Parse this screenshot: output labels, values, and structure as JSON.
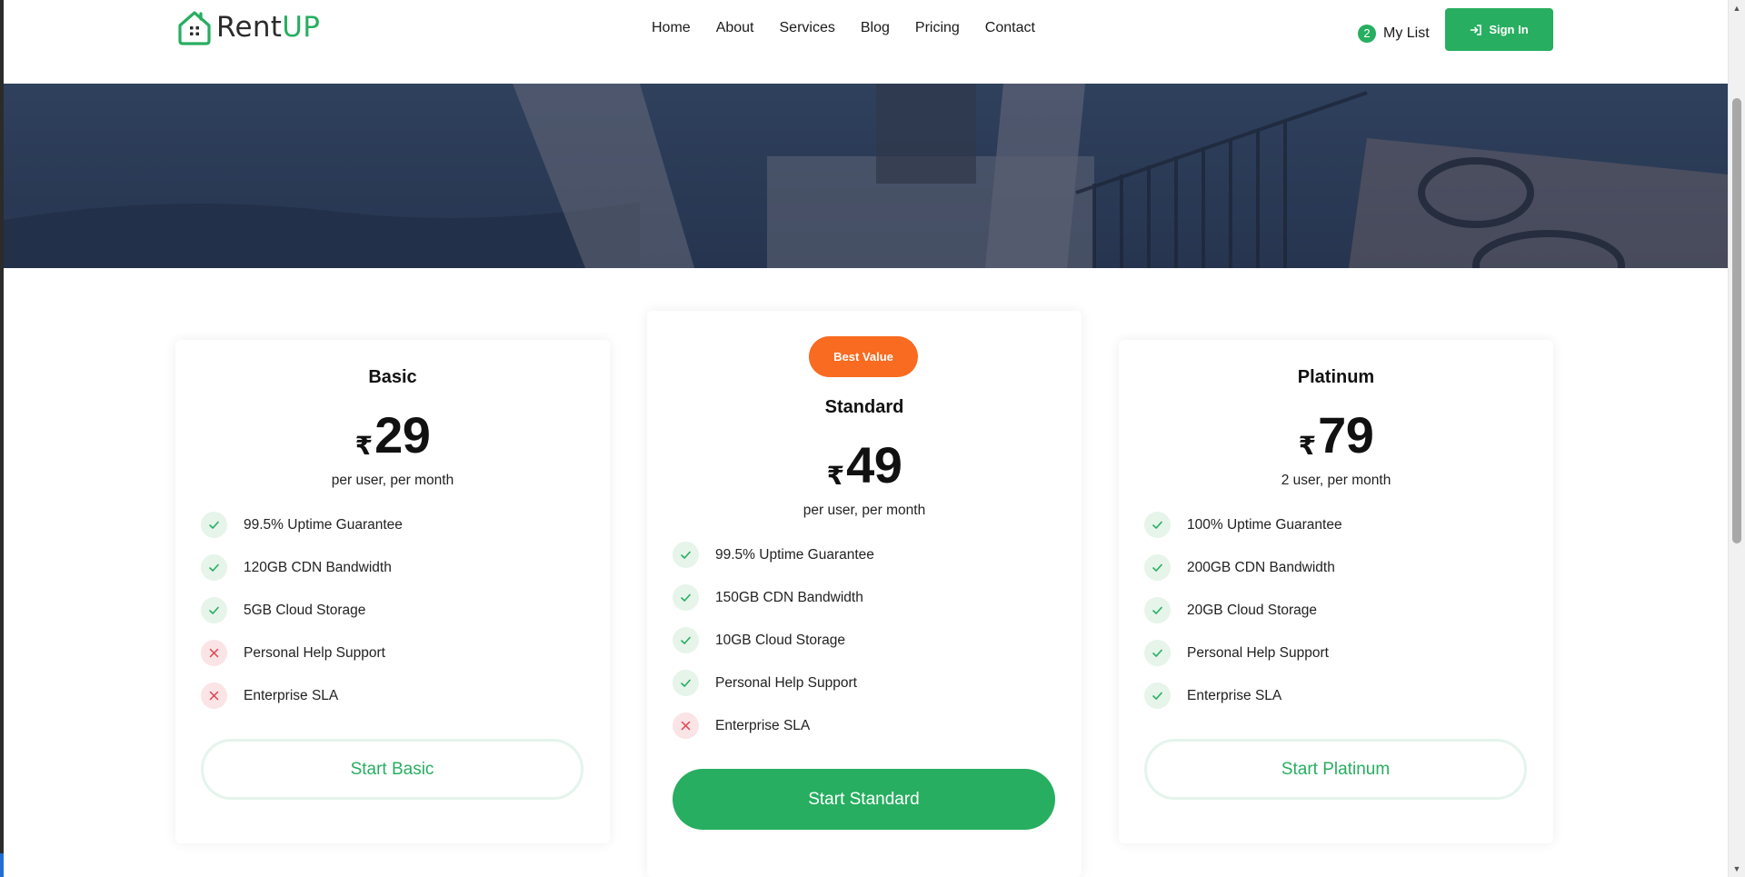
{
  "brand": {
    "name_part1": "Rent",
    "name_part2": "UP",
    "colors": {
      "primary": "#27ae60",
      "badge": "#f96b20",
      "negative": "#e0434f"
    }
  },
  "nav": {
    "items": [
      {
        "label": "Home"
      },
      {
        "label": "About"
      },
      {
        "label": "Services"
      },
      {
        "label": "Blog"
      },
      {
        "label": "Pricing"
      },
      {
        "label": "Contact"
      }
    ]
  },
  "mylist": {
    "count": "2",
    "label": "My List"
  },
  "signin": {
    "label": "Sign In",
    "icon": "sign-in-icon"
  },
  "hero": {
    "image": "hotel-balcony-sea-view"
  },
  "plans": [
    {
      "name": "Basic",
      "currency": "₹",
      "price": "29",
      "period": "per user, per month",
      "features": [
        {
          "label": "99.5% Uptime Guarantee",
          "included": true
        },
        {
          "label": "120GB CDN Bandwidth",
          "included": true
        },
        {
          "label": "5GB Cloud Storage",
          "included": true
        },
        {
          "label": "Personal Help Support",
          "included": false
        },
        {
          "label": "Enterprise SLA",
          "included": false
        }
      ],
      "cta": "Start Basic"
    },
    {
      "badge": "Best Value",
      "name": "Standard",
      "currency": "₹",
      "price": "49",
      "period": "per user, per month",
      "features": [
        {
          "label": "99.5% Uptime Guarantee",
          "included": true
        },
        {
          "label": "150GB CDN Bandwidth",
          "included": true
        },
        {
          "label": "10GB Cloud Storage",
          "included": true
        },
        {
          "label": "Personal Help Support",
          "included": true
        },
        {
          "label": "Enterprise SLA",
          "included": false
        }
      ],
      "cta": "Start Standard"
    },
    {
      "name": "Platinum",
      "currency": "₹",
      "price": "79",
      "period": "2 user, per month",
      "features": [
        {
          "label": "100% Uptime Guarantee",
          "included": true
        },
        {
          "label": "200GB CDN Bandwidth",
          "included": true
        },
        {
          "label": "20GB Cloud Storage",
          "included": true
        },
        {
          "label": "Personal Help Support",
          "included": true
        },
        {
          "label": "Enterprise SLA",
          "included": true
        }
      ],
      "cta": "Start Platinum"
    }
  ]
}
